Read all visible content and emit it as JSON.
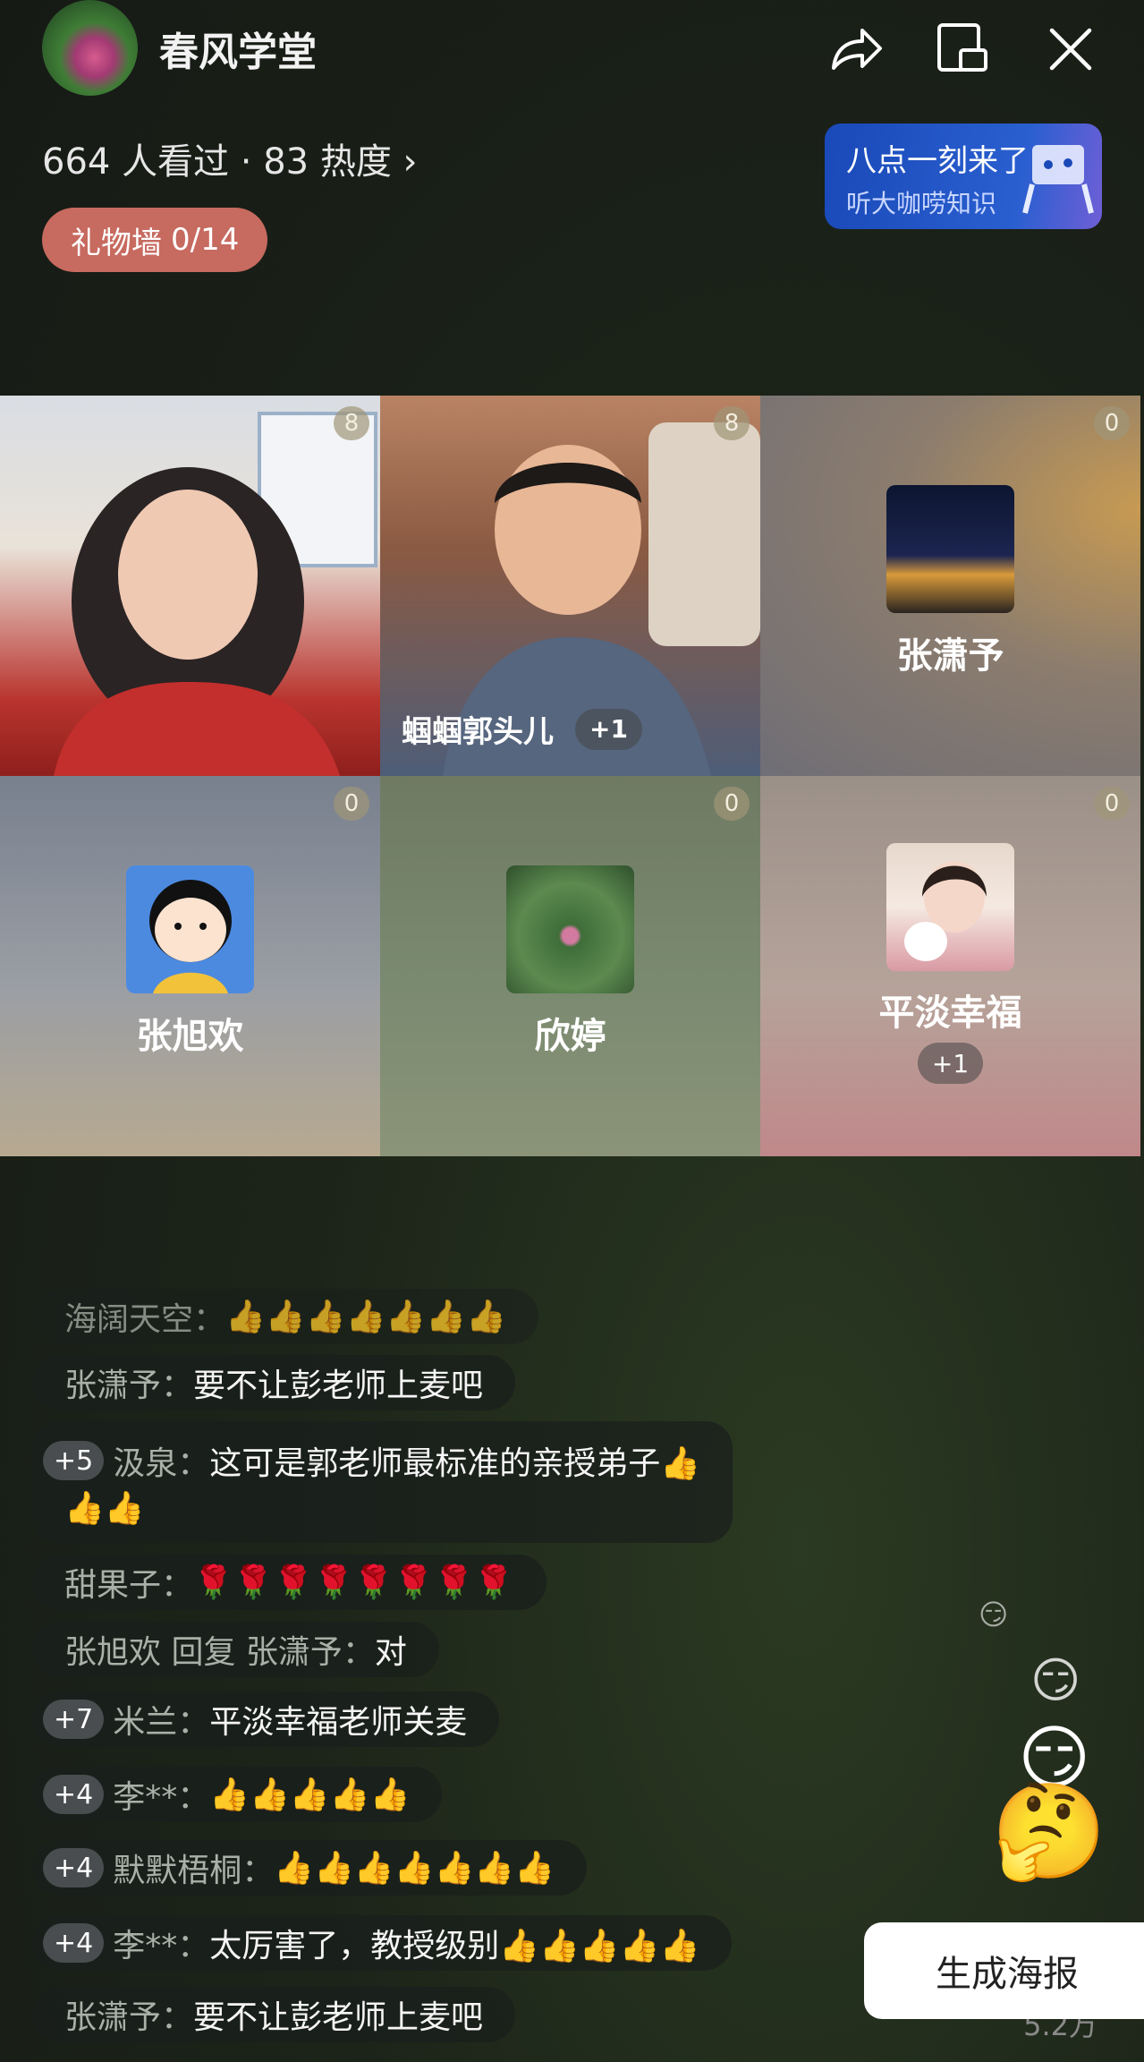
{
  "header": {
    "room_title": "春风学堂",
    "stats": "664 人看过 · 83 热度 ›",
    "gift_wall_label": "礼物墙",
    "gift_wall_count": "0/14",
    "promo_title": "八点一刻来了",
    "promo_subtitle": "听大咖唠知识"
  },
  "grid": [
    {
      "name": "",
      "badge": "8"
    },
    {
      "name": "蝈蝈郭头儿",
      "badge": "8",
      "plus": "+1"
    },
    {
      "name": "张潇予",
      "badge": "0"
    },
    {
      "name": "张旭欢",
      "badge": "0"
    },
    {
      "name": "欣婷",
      "badge": "0"
    },
    {
      "name": "平淡幸福",
      "badge": "0",
      "plus": "+1"
    }
  ],
  "chat": [
    {
      "user": "海阔天空：",
      "text": "👍👍👍👍👍👍👍"
    },
    {
      "user": "张潇予：",
      "text": "要不让彭老师上麦吧"
    },
    {
      "level": "+5",
      "user": "汲泉：",
      "text": "这可是郭老师最标准的亲授弟子👍",
      "text2": "👍👍"
    },
    {
      "user": "甜果子：",
      "text": "🌹🌹🌹🌹🌹🌹🌹🌹"
    },
    {
      "user": "张旭欢 回复 张潇予：",
      "text": "对"
    },
    {
      "level": "+7",
      "user": "米兰：",
      "text": "平淡幸福老师关麦"
    },
    {
      "level": "+4",
      "user": "李**：",
      "text": "👍👍👍👍👍"
    },
    {
      "level": "+4",
      "user": "默默梧桐：",
      "text": "👍👍👍👍👍👍👍"
    },
    {
      "level": "+4",
      "user": "李**：",
      "text": "太厉害了，教授级别👍👍👍👍👍"
    },
    {
      "user": "张潇予：",
      "text": "要不让彭老师上麦吧"
    }
  ],
  "poster_button": "生成海报",
  "like_count": "5.2万"
}
